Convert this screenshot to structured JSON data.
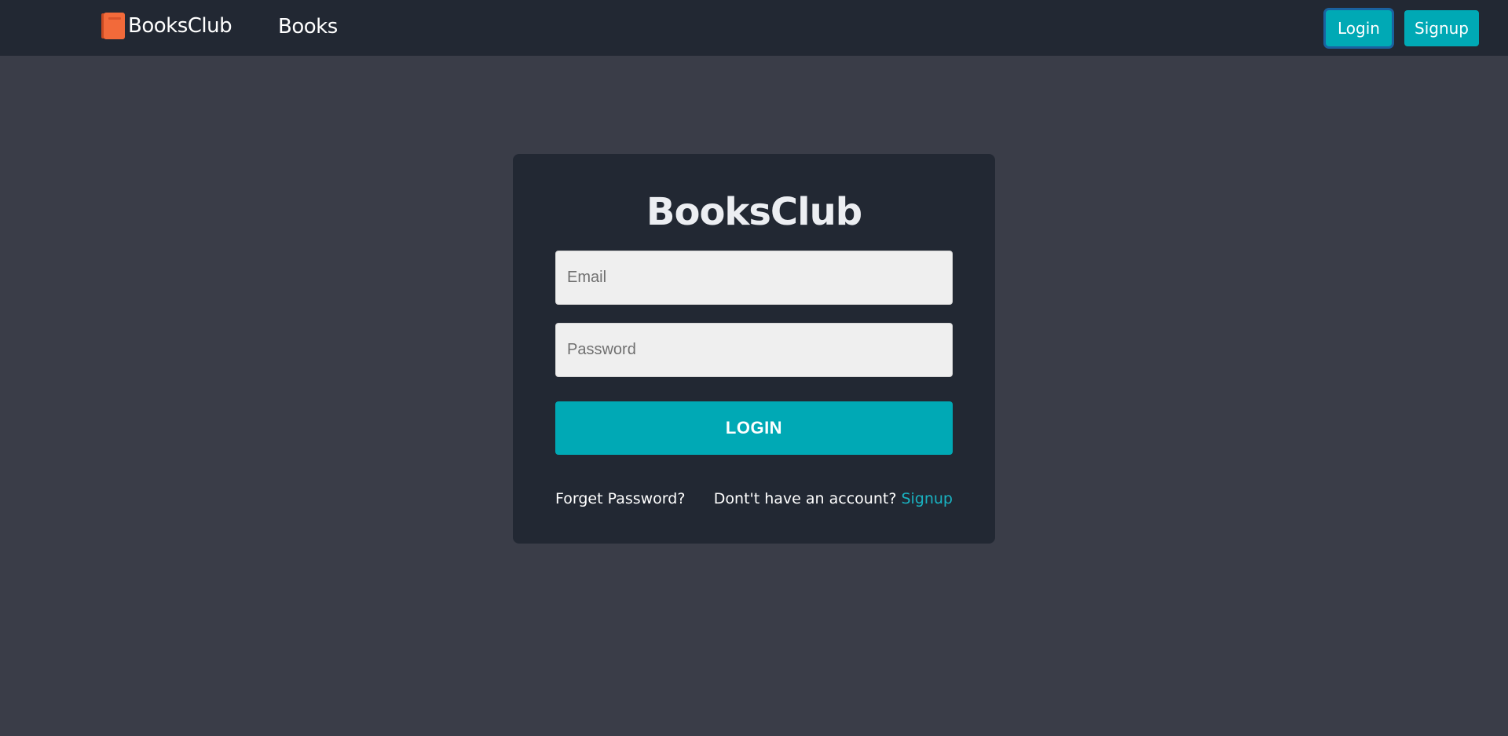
{
  "navbar": {
    "brand_name": "BooksClub",
    "brand_icon": "book-icon",
    "links": [
      {
        "label": "Books"
      }
    ],
    "login_label": "Login",
    "signup_label": "Signup"
  },
  "login_card": {
    "title": "BooksClub",
    "email_placeholder": "Email",
    "email_value": "",
    "password_placeholder": "Password",
    "password_value": "",
    "submit_label": "LOGIN",
    "forgot_password_label": "Forget Password?",
    "signup_prompt": "Dont't have an account?",
    "signup_link_label": "Signup"
  },
  "colors": {
    "navbar_bg": "#222833",
    "page_bg": "#3a3d48",
    "card_bg": "#222833",
    "accent": "#00a9b5",
    "link": "#19b3c2",
    "brand_icon": "#f26a3a",
    "input_bg": "#efefef"
  }
}
